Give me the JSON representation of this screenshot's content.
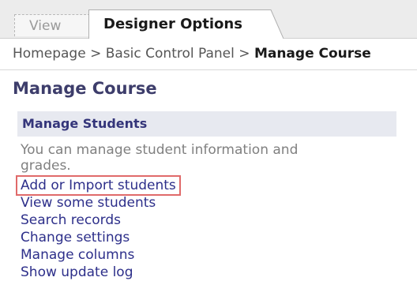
{
  "tabs": {
    "view_label": "View",
    "designer_label": "Designer Options"
  },
  "breadcrumb": {
    "home": "Homepage",
    "separator": ">",
    "panel": "Basic Control Panel",
    "current": "Manage Course"
  },
  "page": {
    "title": "Manage Course"
  },
  "section": {
    "title": "Manage Students",
    "description": "You can manage student information and grades."
  },
  "links": [
    {
      "label": "Add or Import students",
      "highlighted": true
    },
    {
      "label": "View some students"
    },
    {
      "label": "Search records"
    },
    {
      "label": "Change settings"
    },
    {
      "label": "Manage columns"
    },
    {
      "label": "Show update log"
    }
  ],
  "colors": {
    "link": "#2d2f8a",
    "section_bg": "#e7e9f0",
    "highlight_border": "#e06a6a"
  }
}
